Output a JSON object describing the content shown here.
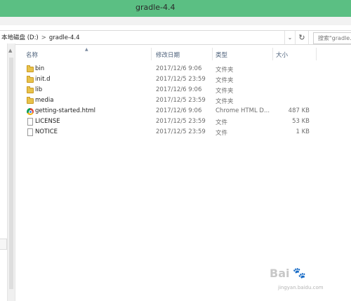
{
  "window": {
    "title": "gradle-4.4"
  },
  "address_bar": {
    "drive": "本地磁盘 (D:)",
    "separator": ">",
    "folder": "gradle-4.4",
    "dropdown_icon": "chevron-down-icon",
    "refresh_icon": "refresh-icon",
    "search_placeholder": "搜索\"gradle..."
  },
  "columns": {
    "name": "名称",
    "date": "修改日期",
    "type": "类型",
    "size": "大小"
  },
  "files": [
    {
      "name": "bin",
      "date": "2017/12/6 9:06",
      "type": "文件夹",
      "size": "",
      "icon": "folder-icon"
    },
    {
      "name": "init.d",
      "date": "2017/12/5 23:59",
      "type": "文件夹",
      "size": "",
      "icon": "folder-icon"
    },
    {
      "name": "lib",
      "date": "2017/12/6 9:06",
      "type": "文件夹",
      "size": "",
      "icon": "folder-icon"
    },
    {
      "name": "media",
      "date": "2017/12/5 23:59",
      "type": "文件夹",
      "size": "",
      "icon": "folder-icon"
    },
    {
      "name": "getting-started.html",
      "date": "2017/12/6 9:06",
      "type": "Chrome HTML D...",
      "size": "487 KB",
      "icon": "chrome-icon"
    },
    {
      "name": "LICENSE",
      "date": "2017/12/5 23:59",
      "type": "文件",
      "size": "53 KB",
      "icon": "file-icon"
    },
    {
      "name": "NOTICE",
      "date": "2017/12/5 23:59",
      "type": "文件",
      "size": "1 KB",
      "icon": "file-icon"
    }
  ],
  "watermark": {
    "logo": "Bai",
    "paw": "🐾",
    "url": "jingyan.baidu.com"
  }
}
